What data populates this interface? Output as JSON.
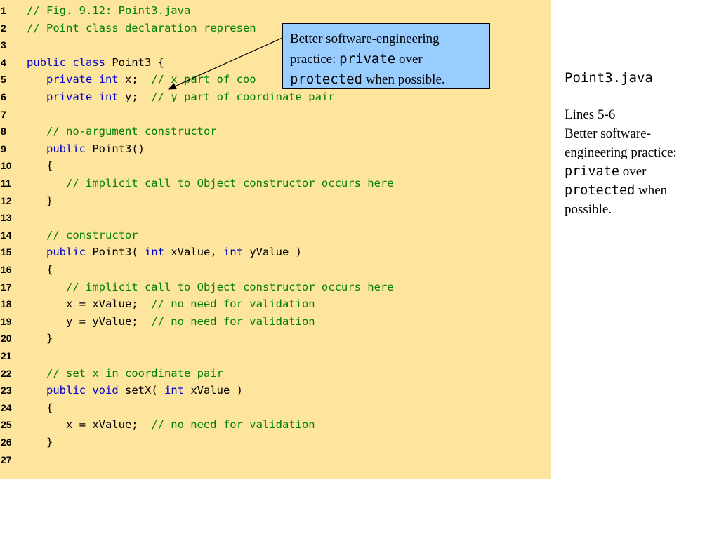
{
  "code_lines": [
    {
      "n": "1",
      "tokens": [
        {
          "t": "// Fig. 9.12: Point3.java",
          "k": "cm"
        }
      ]
    },
    {
      "n": "2",
      "tokens": [
        {
          "t": "// Point class declaration represen",
          "k": "cm"
        }
      ]
    },
    {
      "n": "3",
      "tokens": []
    },
    {
      "n": "4",
      "tokens": [
        {
          "t": "public class",
          "k": "kw"
        },
        {
          "t": " Point3 {",
          "k": "tx"
        }
      ]
    },
    {
      "n": "5",
      "tokens": [
        {
          "t": "   private int",
          "k": "kw"
        },
        {
          "t": " x;  ",
          "k": "tx"
        },
        {
          "t": "// x part of coo",
          "k": "cm"
        }
      ]
    },
    {
      "n": "6",
      "tokens": [
        {
          "t": "   private int",
          "k": "kw"
        },
        {
          "t": " y;  ",
          "k": "tx"
        },
        {
          "t": "// y part of coordinate pair",
          "k": "cm"
        }
      ]
    },
    {
      "n": "7",
      "tokens": []
    },
    {
      "n": "8",
      "tokens": [
        {
          "t": "   // no-argument constructor",
          "k": "cm"
        }
      ]
    },
    {
      "n": "9",
      "tokens": [
        {
          "t": "   public",
          "k": "kw"
        },
        {
          "t": " Point3()",
          "k": "tx"
        }
      ]
    },
    {
      "n": "10",
      "tokens": [
        {
          "t": "   {",
          "k": "tx"
        }
      ]
    },
    {
      "n": "11",
      "tokens": [
        {
          "t": "      // implicit call to Object constructor occurs here",
          "k": "cm"
        }
      ]
    },
    {
      "n": "12",
      "tokens": [
        {
          "t": "   }",
          "k": "tx"
        }
      ]
    },
    {
      "n": "13",
      "tokens": []
    },
    {
      "n": "14",
      "tokens": [
        {
          "t": "   // constructor",
          "k": "cm"
        }
      ]
    },
    {
      "n": "15",
      "tokens": [
        {
          "t": "   public",
          "k": "kw"
        },
        {
          "t": " Point3( ",
          "k": "tx"
        },
        {
          "t": "int",
          "k": "kw"
        },
        {
          "t": " xValue, ",
          "k": "tx"
        },
        {
          "t": "int",
          "k": "kw"
        },
        {
          "t": " yValue )",
          "k": "tx"
        }
      ]
    },
    {
      "n": "16",
      "tokens": [
        {
          "t": "   {",
          "k": "tx"
        }
      ]
    },
    {
      "n": "17",
      "tokens": [
        {
          "t": "      // implicit call to Object constructor occurs here",
          "k": "cm"
        }
      ]
    },
    {
      "n": "18",
      "tokens": [
        {
          "t": "      x = xValue;  ",
          "k": "tx"
        },
        {
          "t": "// no need for validation",
          "k": "cm"
        }
      ]
    },
    {
      "n": "19",
      "tokens": [
        {
          "t": "      y = yValue;  ",
          "k": "tx"
        },
        {
          "t": "// no need for validation",
          "k": "cm"
        }
      ]
    },
    {
      "n": "20",
      "tokens": [
        {
          "t": "   }",
          "k": "tx"
        }
      ]
    },
    {
      "n": "21",
      "tokens": []
    },
    {
      "n": "22",
      "tokens": [
        {
          "t": "   // set x in coordinate pair",
          "k": "cm"
        }
      ]
    },
    {
      "n": "23",
      "tokens": [
        {
          "t": "   public void",
          "k": "kw"
        },
        {
          "t": " setX( ",
          "k": "tx"
        },
        {
          "t": "int",
          "k": "kw"
        },
        {
          "t": " xValue )",
          "k": "tx"
        }
      ]
    },
    {
      "n": "24",
      "tokens": [
        {
          "t": "   {",
          "k": "tx"
        }
      ]
    },
    {
      "n": "25",
      "tokens": [
        {
          "t": "      x = xValue;  ",
          "k": "tx"
        },
        {
          "t": "// no need for validation",
          "k": "cm"
        }
      ]
    },
    {
      "n": "26",
      "tokens": [
        {
          "t": "   }",
          "k": "tx"
        }
      ]
    },
    {
      "n": "27",
      "tokens": []
    }
  ],
  "callout": {
    "line1": "Better software-engineering",
    "line2_a": "practice: ",
    "line2_code": "private",
    "line2_b": " over",
    "line3_code": "protected",
    "line3_b": " when possible."
  },
  "sidebar": {
    "filename": "Point3.java",
    "lines_label": "Lines 5-6",
    "desc_a": "Better software-engineering practice: ",
    "desc_code1": "private",
    "desc_b": " over",
    "desc_code2": "protected",
    "desc_c": " when possible."
  },
  "colors": {
    "code_background": "#fde59e",
    "keyword": "#0000cc",
    "comment": "#008000",
    "callout_background": "#99ccff"
  }
}
